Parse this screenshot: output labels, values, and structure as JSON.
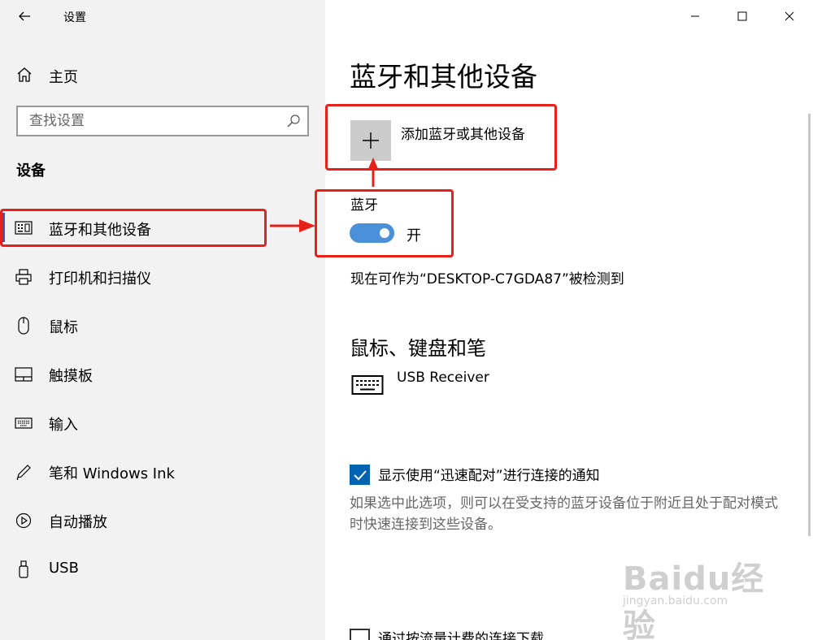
{
  "window": {
    "title": "设置"
  },
  "sidebar": {
    "home_label": "主页",
    "search_placeholder": "查找设置",
    "section_title": "设备",
    "items": [
      {
        "label": "蓝牙和其他设备",
        "icon": "bluetooth-devices-icon",
        "active": true
      },
      {
        "label": "打印机和扫描仪",
        "icon": "printer-icon"
      },
      {
        "label": "鼠标",
        "icon": "mouse-icon"
      },
      {
        "label": "触摸板",
        "icon": "touchpad-icon"
      },
      {
        "label": "输入",
        "icon": "keyboard-icon"
      },
      {
        "label": "笔和 Windows Ink",
        "icon": "pen-icon"
      },
      {
        "label": "自动播放",
        "icon": "autoplay-icon"
      },
      {
        "label": "USB",
        "icon": "usb-icon"
      }
    ]
  },
  "main": {
    "title": "蓝牙和其他设备",
    "add_device_label": "添加蓝牙或其他设备",
    "bluetooth_label": "蓝牙",
    "bluetooth_state": "开",
    "bluetooth_on": true,
    "discoverable_text": "现在可作为“DESKTOP-C7GDA87”被检测到",
    "mouse_section_title": "鼠标、键盘和笔",
    "devices": [
      {
        "name": "USB Receiver",
        "icon": "keyboard-icon"
      }
    ],
    "swift_pair_label": "显示使用“迅速配对”进行连接的通知",
    "swift_pair_checked": true,
    "swift_pair_description": "如果选中此选项，则可以在受支持的蓝牙设备位于附近且处于配对模式时快速连接到这些设备。",
    "metered_label": "通过按流量计费的连接下载",
    "metered_checked": false
  },
  "watermark": {
    "logo": "Baidu经验",
    "url": "jingyan.baidu.com"
  },
  "colors": {
    "sidebar_bg": "#f2f2f2",
    "accent": "#0063b1",
    "toggle_on": "#4a90d9",
    "active_indicator": "#3a56b6",
    "annotation_red": "#e8201a"
  }
}
